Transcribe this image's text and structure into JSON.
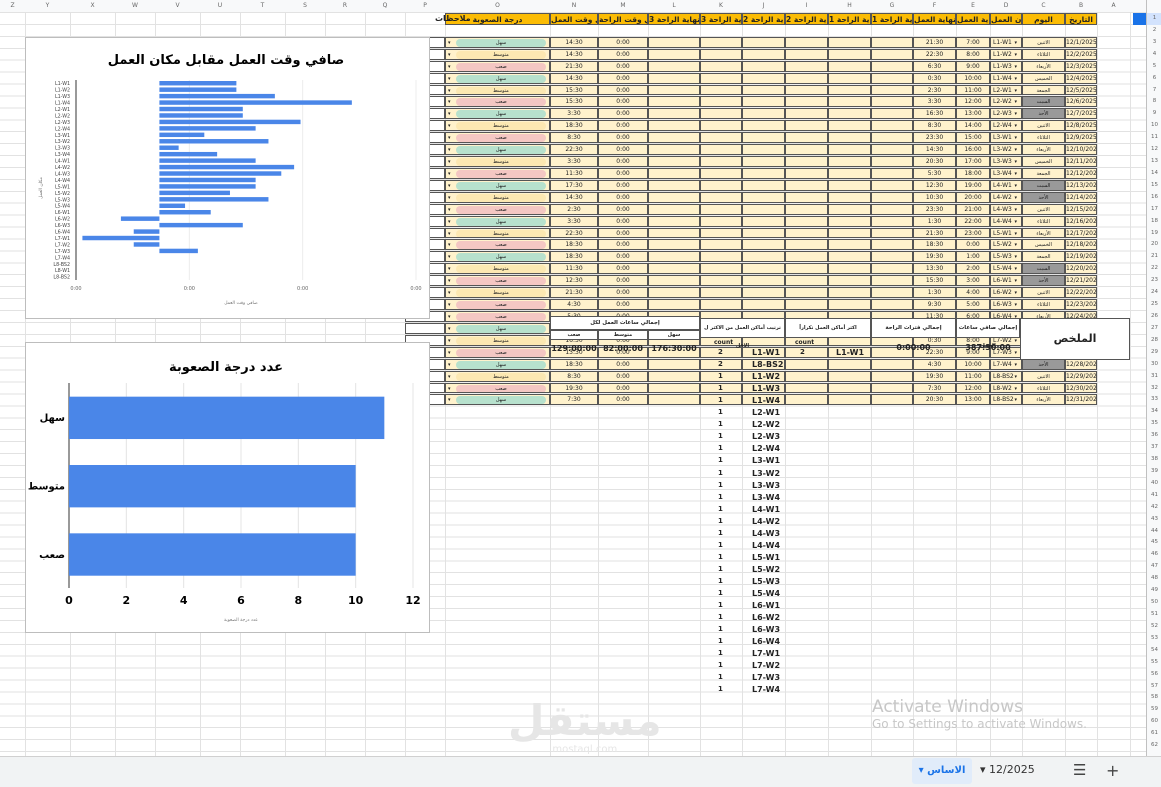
{
  "columns_ltr": [
    "Z",
    "Y",
    "X",
    "W",
    "V",
    "U",
    "T",
    "S",
    "R",
    "Q",
    "P",
    "O",
    "N",
    "M",
    "L",
    "K",
    "J",
    "I",
    "H",
    "G",
    "F",
    "E",
    "D",
    "C",
    "B",
    "A"
  ],
  "headers": {
    "date": "التاريخ",
    "day": "اليوم",
    "place": "مكان العمل",
    "work_start": "بداية العمل",
    "work_end": "نهاية العمل",
    "b1_start": "بداية الراحة 1",
    "b1_end": "نهاية الراحة 1",
    "b2_start": "بداية الراحة 2",
    "b2_end": "نهاية الراحة 2",
    "b3_start": "بداية الراحة 3",
    "b3_end": "نهاية الراحة 3",
    "total_break": "إجمالي وقت الراحة",
    "net_work": "صافي وقت العمل",
    "difficulty": "درجة الصعوبة",
    "notes": "ملاحظات"
  },
  "rows": [
    {
      "date": "12/1/2025",
      "day": "الاثنين",
      "place": "L1-W1",
      "start": "7:00",
      "end": "21:30",
      "break": "0:00",
      "net": "14:30",
      "diff": "سهل"
    },
    {
      "date": "12/2/2025",
      "day": "الثلاثاء",
      "place": "L1-W2",
      "start": "8:00",
      "end": "22:30",
      "break": "0:00",
      "net": "14:30",
      "diff": "متوسط"
    },
    {
      "date": "12/3/2025",
      "day": "الأربعاء",
      "place": "L1-W3",
      "start": "9:00",
      "end": "6:30",
      "break": "0:00",
      "net": "21:30",
      "diff": "صعب"
    },
    {
      "date": "12/4/2025",
      "day": "الخميس",
      "place": "L1-W4",
      "start": "10:00",
      "end": "0:30",
      "break": "0:00",
      "net": "14:30",
      "diff": "سهل"
    },
    {
      "date": "12/5/2025",
      "day": "الجمعة",
      "place": "L2-W1",
      "start": "11:00",
      "end": "2:30",
      "break": "0:00",
      "net": "15:30",
      "diff": "متوسط"
    },
    {
      "date": "12/6/2025",
      "day": "السبت",
      "place": "L2-W2",
      "start": "12:00",
      "end": "3:30",
      "break": "0:00",
      "net": "15:30",
      "diff": "صعب"
    },
    {
      "date": "12/7/2025",
      "day": "الأحد",
      "place": "L2-W3",
      "start": "13:00",
      "end": "16:30",
      "break": "0:00",
      "net": "3:30",
      "diff": "سهل"
    },
    {
      "date": "12/8/2025",
      "day": "الاثنين",
      "place": "L2-W4",
      "start": "14:00",
      "end": "8:30",
      "break": "0:00",
      "net": "18:30",
      "diff": "متوسط"
    },
    {
      "date": "12/9/2025",
      "day": "الثلاثاء",
      "place": "L3-W1",
      "start": "15:00",
      "end": "23:30",
      "break": "0:00",
      "net": "8:30",
      "diff": "صعب"
    },
    {
      "date": "12/10/2025",
      "day": "الأربعاء",
      "place": "L3-W2",
      "start": "16:00",
      "end": "14:30",
      "break": "0:00",
      "net": "22:30",
      "diff": "سهل"
    },
    {
      "date": "12/11/2025",
      "day": "الخميس",
      "place": "L3-W3",
      "start": "17:00",
      "end": "20:30",
      "break": "0:00",
      "net": "3:30",
      "diff": "متوسط"
    },
    {
      "date": "12/12/2025",
      "day": "الجمعة",
      "place": "L3-W4",
      "start": "18:00",
      "end": "5:30",
      "break": "0:00",
      "net": "11:30",
      "diff": "صعب"
    },
    {
      "date": "12/13/2025",
      "day": "السبت",
      "place": "L4-W1",
      "start": "19:00",
      "end": "12:30",
      "break": "0:00",
      "net": "17:30",
      "diff": "سهل"
    },
    {
      "date": "12/14/2025",
      "day": "الأحد",
      "place": "L4-W2",
      "start": "20:00",
      "end": "10:30",
      "break": "0:00",
      "net": "14:30",
      "diff": "متوسط"
    },
    {
      "date": "12/15/2025",
      "day": "الاثنين",
      "place": "L4-W3",
      "start": "21:00",
      "end": "23:30",
      "break": "0:00",
      "net": "2:30",
      "diff": "صعب"
    },
    {
      "date": "12/16/2025",
      "day": "الثلاثاء",
      "place": "L4-W4",
      "start": "22:00",
      "end": "1:30",
      "break": "0:00",
      "net": "3:30",
      "diff": "سهل"
    },
    {
      "date": "12/17/2025",
      "day": "الأربعاء",
      "place": "L5-W1",
      "start": "23:00",
      "end": "21:30",
      "break": "0:00",
      "net": "22:30",
      "diff": "متوسط"
    },
    {
      "date": "12/18/2025",
      "day": "الخميس",
      "place": "L5-W2",
      "start": "0:00",
      "end": "18:30",
      "break": "0:00",
      "net": "18:30",
      "diff": "صعب"
    },
    {
      "date": "12/19/2025",
      "day": "الجمعة",
      "place": "L5-W3",
      "start": "1:00",
      "end": "19:30",
      "break": "0:00",
      "net": "18:30",
      "diff": "سهل"
    },
    {
      "date": "12/20/2025",
      "day": "السبت",
      "place": "L5-W4",
      "start": "2:00",
      "end": "13:30",
      "break": "0:00",
      "net": "11:30",
      "diff": "متوسط"
    },
    {
      "date": "12/21/2025",
      "day": "الأحد",
      "place": "L6-W1",
      "start": "3:00",
      "end": "15:30",
      "break": "0:00",
      "net": "12:30",
      "diff": "صعب"
    },
    {
      "date": "12/22/2025",
      "day": "الاثنين",
      "place": "L6-W2",
      "start": "4:00",
      "end": "1:30",
      "break": "0:00",
      "net": "21:30",
      "diff": "متوسط"
    },
    {
      "date": "12/23/2025",
      "day": "الثلاثاء",
      "place": "L6-W3",
      "start": "5:00",
      "end": "9:30",
      "break": "0:00",
      "net": "4:30",
      "diff": "صعب"
    },
    {
      "date": "12/24/2025",
      "day": "الأربعاء",
      "place": "L6-W4",
      "start": "6:00",
      "end": "11:30",
      "break": "0:00",
      "net": "5:30",
      "diff": "صعب"
    },
    {
      "date": "12/25/2025",
      "day": "الخميس",
      "place": "L7-W1",
      "start": "7:00",
      "end": "17:30",
      "break": "0:00",
      "net": "10:30",
      "diff": "سهل"
    },
    {
      "date": "12/26/2025",
      "day": "الجمعة",
      "place": "L7-W2",
      "start": "8:00",
      "end": "0:30",
      "break": "0:00",
      "net": "16:30",
      "diff": "متوسط"
    },
    {
      "date": "12/27/2025",
      "day": "السبت",
      "place": "L7-W3",
      "start": "9:00",
      "end": "22:30",
      "break": "0:00",
      "net": "13:30",
      "diff": "صعب"
    },
    {
      "date": "12/28/2025",
      "day": "الأحد",
      "place": "L7-W4",
      "start": "10:00",
      "end": "4:30",
      "break": "0:00",
      "net": "18:30",
      "diff": "سهل"
    },
    {
      "date": "12/29/2025",
      "day": "الاثنين",
      "place": "L8-BS2",
      "start": "11:00",
      "end": "19:30",
      "break": "0:00",
      "net": "8:30",
      "diff": "متوسط"
    },
    {
      "date": "12/30/2025",
      "day": "الثلاثاء",
      "place": "L8-W2",
      "start": "12:00",
      "end": "7:30",
      "break": "0:00",
      "net": "19:30",
      "diff": "صعب"
    },
    {
      "date": "12/31/2025",
      "day": "الأربعاء",
      "place": "L8-BS2",
      "start": "13:00",
      "end": "20:30",
      "break": "0:00",
      "net": "7:30",
      "diff": "سهل"
    }
  ],
  "summary": {
    "title": "الملخص",
    "net_total_label": "إجمالي صافي ساعات العمل",
    "net_total": "387:30:00",
    "breaks_total_label": "إجمالي فترات الراحة",
    "breaks_total": "0:00:00",
    "most_repeated_label": "اكثر أماكن العمل تكراراً",
    "count_label": "count",
    "most_repeated_place": "L1-W1",
    "most_repeated_count": "2",
    "ranking_label": "ترتيب أماكن العمل من الاكثر ل الاقل",
    "ranking_count_label": "count",
    "hours_by_diff_label": "إجمالي ساعات العمل لكل",
    "diff_cols": [
      {
        "label": "سهل",
        "value": "176:30:00"
      },
      {
        "label": "متوسط",
        "value": "82:00:00"
      },
      {
        "label": "صعب",
        "value": "129:00:00"
      }
    ]
  },
  "ranking": [
    {
      "place": "L1-W1",
      "count": "2"
    },
    {
      "place": "L8-BS2",
      "count": "2"
    },
    {
      "place": "L1-W2",
      "count": "1"
    },
    {
      "place": "L1-W3",
      "count": "1"
    },
    {
      "place": "L1-W4",
      "count": "1"
    },
    {
      "place": "L2-W1",
      "count": "1"
    },
    {
      "place": "L2-W2",
      "count": "1"
    },
    {
      "place": "L2-W3",
      "count": "1"
    },
    {
      "place": "L2-W4",
      "count": "1"
    },
    {
      "place": "L3-W1",
      "count": "1"
    },
    {
      "place": "L3-W2",
      "count": "1"
    },
    {
      "place": "L3-W3",
      "count": "1"
    },
    {
      "place": "L3-W4",
      "count": "1"
    },
    {
      "place": "L4-W1",
      "count": "1"
    },
    {
      "place": "L4-W2",
      "count": "1"
    },
    {
      "place": "L4-W3",
      "count": "1"
    },
    {
      "place": "L4-W4",
      "count": "1"
    },
    {
      "place": "L5-W1",
      "count": "1"
    },
    {
      "place": "L5-W2",
      "count": "1"
    },
    {
      "place": "L5-W3",
      "count": "1"
    },
    {
      "place": "L5-W4",
      "count": "1"
    },
    {
      "place": "L6-W1",
      "count": "1"
    },
    {
      "place": "L6-W2",
      "count": "1"
    },
    {
      "place": "L6-W3",
      "count": "1"
    },
    {
      "place": "L6-W4",
      "count": "1"
    },
    {
      "place": "L7-W1",
      "count": "1"
    },
    {
      "place": "L7-W2",
      "count": "1"
    },
    {
      "place": "L7-W3",
      "count": "1"
    },
    {
      "place": "L7-W4",
      "count": "1"
    }
  ],
  "chart_data": [
    {
      "type": "bar",
      "orientation": "horizontal",
      "title": "صافي وقت العمل مقابل مكان العمل",
      "xlabel": "صافي وقت العمل",
      "ylabel": "مكان العمل",
      "xtick_labels": [
        "0:00",
        "0:00",
        "0:00",
        "0:00"
      ],
      "categories": [
        "L1-W1",
        "L1-W2",
        "L1-W3",
        "L1-W4",
        "L2-W1",
        "L2-W2",
        "L2-W3",
        "L2-W4",
        "L3-W1",
        "L3-W2",
        "L3-W3",
        "L3-W4",
        "L4-W1",
        "L4-W2",
        "L4-W3",
        "L4-W4",
        "L5-W1",
        "L5-W2",
        "L5-W3",
        "L5-W4",
        "L6-W1",
        "L6-W2",
        "L6-W3",
        "L6-W4",
        "L7-W1",
        "L7-W2",
        "L7-W3",
        "L7-W4",
        "L8-BS2",
        "L8-W1",
        "L8-BS2"
      ],
      "values": [
        0.6,
        0.6,
        0.9,
        1.5,
        0.65,
        0.65,
        1.1,
        0.75,
        0.35,
        0.85,
        0.15,
        0.45,
        0.75,
        1.05,
        0.95,
        0.75,
        0.75,
        0.55,
        0.85,
        0.2,
        0.4,
        -0.3,
        0.65,
        -0.2,
        -0.6,
        -0.2,
        0.3
      ],
      "xlim": [
        -0.65,
        2.0
      ],
      "grid": true
    },
    {
      "type": "bar",
      "orientation": "horizontal",
      "title": "عدد درجة الصعوبة",
      "xlabel": "عدد درجة الصعوبة",
      "categories": [
        "سهل",
        "متوسط",
        "صعب"
      ],
      "values": [
        11,
        10,
        10
      ],
      "xlim": [
        0,
        12
      ],
      "xticks": [
        0,
        2,
        4,
        6,
        8,
        10,
        12
      ],
      "grid": true
    }
  ],
  "bottom": {
    "add_icon": "plus-icon",
    "menu_icon": "menu-icon",
    "sheet1": "12/2025",
    "sheet2": "الاساس",
    "activate_title": "Activate Windows",
    "activate_sub": "Go to Settings to activate Windows.",
    "watermark": "مستقل",
    "watermark_sub": "mostaql.com"
  },
  "colors": {
    "header_fill": "#fbbc04",
    "easy": "#b7e1cd",
    "medium": "#fce8b2",
    "hard": "#f4c7c3",
    "bar": "#4a86e8",
    "gray_day": "#999999"
  }
}
